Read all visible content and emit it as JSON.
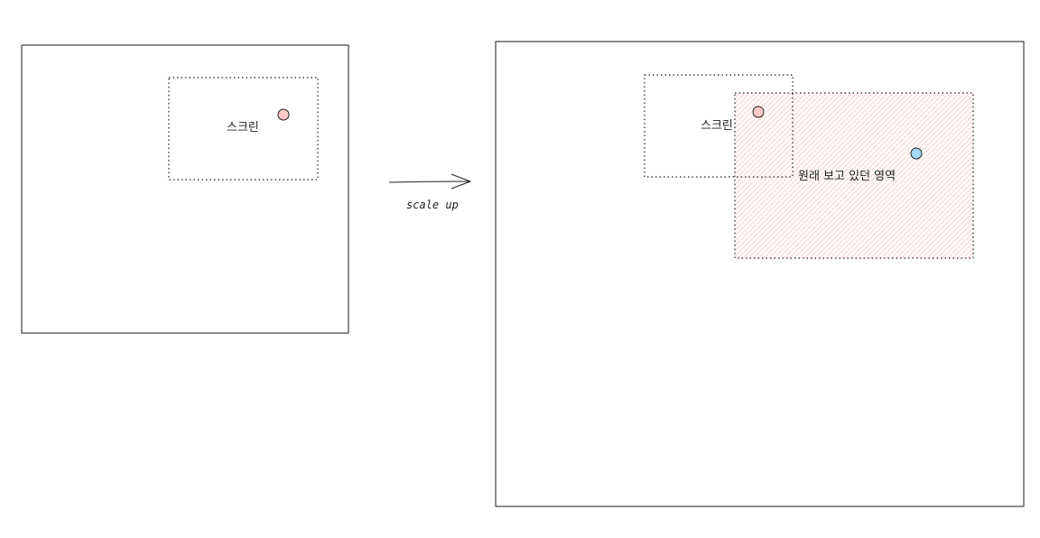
{
  "labels": {
    "left_screen": "스크린",
    "right_screen": "스크린",
    "original_area": "원래 보고 있던 영역",
    "arrow": "scale up"
  },
  "colors": {
    "stroke": "#1e1e1e",
    "red_dot": "#ffc9c9",
    "blue_dot": "#a5d8ff",
    "hatch": "#ffb3b3"
  }
}
